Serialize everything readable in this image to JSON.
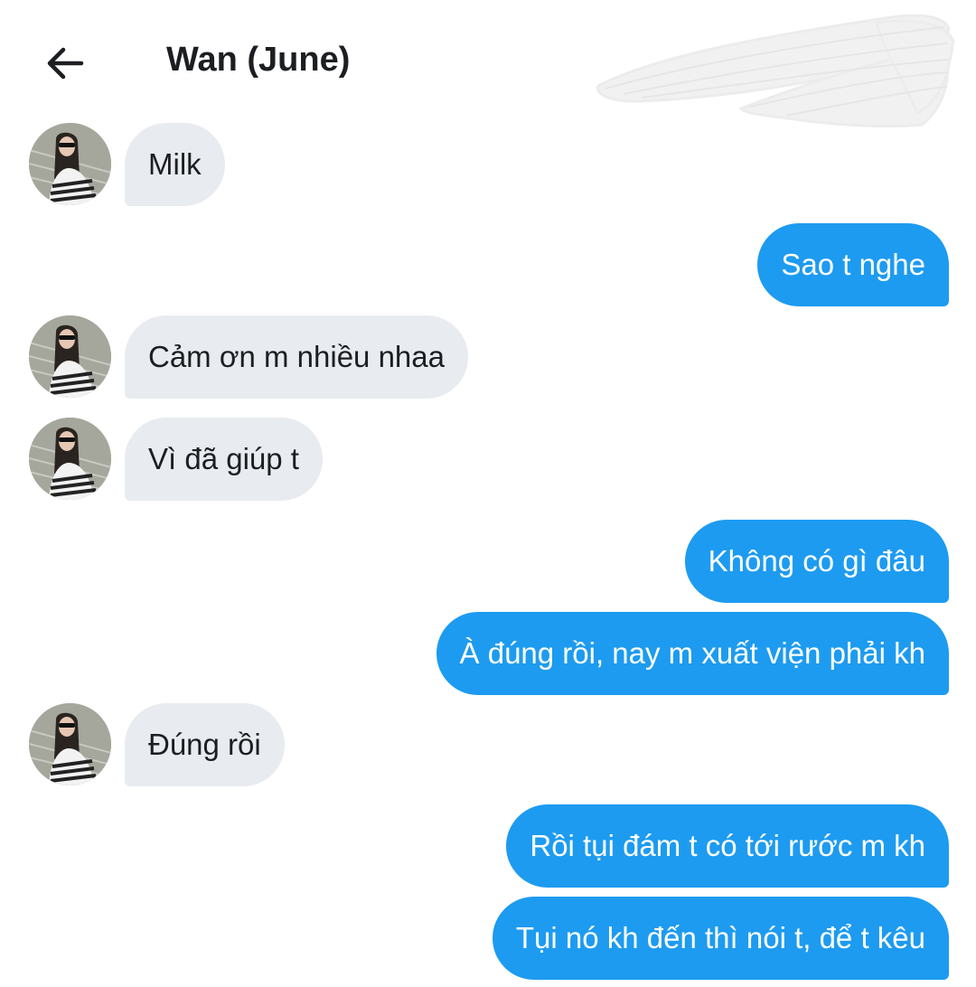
{
  "header": {
    "back_icon": "arrow-left-icon",
    "title": "Wan (June)"
  },
  "contact": {
    "avatar_icon": "profile-photo"
  },
  "colors": {
    "outgoing_bubble": "#1d9bf0",
    "incoming_bubble": "#e8ebef",
    "outgoing_text": "#ffffff",
    "incoming_text": "#1c1e21"
  },
  "messages": [
    {
      "direction": "incoming",
      "text": "Milk"
    },
    {
      "direction": "outgoing",
      "text": "Sao t nghe"
    },
    {
      "direction": "incoming",
      "text": "Cảm ơn m nhiều nhaa"
    },
    {
      "direction": "incoming",
      "text": "Vì đã giúp t"
    },
    {
      "direction": "outgoing",
      "text": "Không có gì đâu"
    },
    {
      "direction": "outgoing",
      "text": "À đúng rồi, nay m xuất viện phải kh"
    },
    {
      "direction": "incoming",
      "text": "Đúng rồi"
    },
    {
      "direction": "outgoing",
      "text": "Rồi tụi đám t có tới rước m kh"
    },
    {
      "direction": "outgoing",
      "text": "Tụi nó kh đến thì nói t, để t kêu"
    }
  ]
}
